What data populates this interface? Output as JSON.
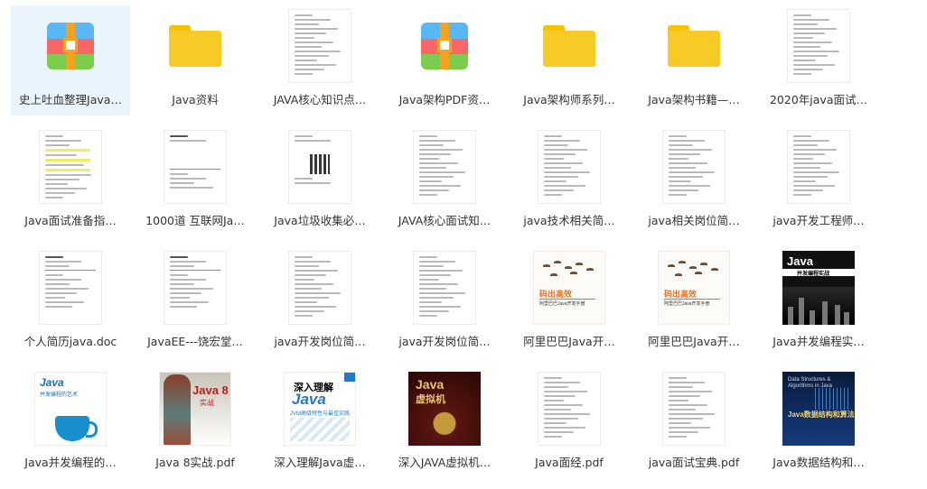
{
  "files": [
    {
      "label": "史上吐血整理Java…",
      "kind": "archive",
      "selected": true
    },
    {
      "label": "Java资料",
      "kind": "folder"
    },
    {
      "label": "JAVA核心知识点…",
      "kind": "doc"
    },
    {
      "label": "Java架构PDF资…",
      "kind": "archive"
    },
    {
      "label": "Java架构师系列…",
      "kind": "folder"
    },
    {
      "label": "Java架构书籍—…",
      "kind": "folder"
    },
    {
      "label": "2020年java面试…",
      "kind": "doc"
    },
    {
      "label": "Java面试准备指…",
      "kind": "doc-yellow"
    },
    {
      "label": "1000道 互联网Ja…",
      "kind": "doc-sparse"
    },
    {
      "label": "Java垃圾收集必…",
      "kind": "doc-qr"
    },
    {
      "label": "JAVA核心面试知…",
      "kind": "doc"
    },
    {
      "label": "java技术相关简…",
      "kind": "doc"
    },
    {
      "label": "java相关岗位简…",
      "kind": "doc"
    },
    {
      "label": "java开发工程师…",
      "kind": "doc"
    },
    {
      "label": "个人简历java.doc",
      "kind": "doc-table"
    },
    {
      "label": "JavaEE---饶宏堂…",
      "kind": "doc-table"
    },
    {
      "label": "java开发岗位简…",
      "kind": "doc"
    },
    {
      "label": "java开发岗位简…",
      "kind": "doc"
    },
    {
      "label": "阿里巴巴Java开…",
      "kind": "cover-ali"
    },
    {
      "label": "阿里巴巴Java开…",
      "kind": "cover-ali"
    },
    {
      "label": "Java并发编程实…",
      "kind": "cover-conc"
    },
    {
      "label": "Java并发编程的…",
      "kind": "cover-art"
    },
    {
      "label": "Java 8实战.pdf",
      "kind": "cover-j8"
    },
    {
      "label": "深入理解Java虚…",
      "kind": "cover-jvm1"
    },
    {
      "label": "深入JAVA虚拟机…",
      "kind": "cover-jvm2"
    },
    {
      "label": "Java面经.pdf",
      "kind": "doc"
    },
    {
      "label": "java面试宝典.pdf",
      "kind": "doc"
    },
    {
      "label": "Java数据结构和…",
      "kind": "cover-ds"
    }
  ],
  "covers": {
    "ali": {
      "title": "码出高效",
      "subtitle": "阿里巴巴Java开发手册"
    },
    "conc": {
      "title": "Java",
      "subtitle": "并发编程实战"
    },
    "art": {
      "title": "Java",
      "subtitle": "并发编程的艺术"
    },
    "j8": {
      "title": "Java 8",
      "subtitle": "实战"
    },
    "jvm1": {
      "title": "深入理解",
      "big": "Java",
      "subtitle": "JVM高级特性与最佳实践"
    },
    "jvm2": {
      "title": "Java",
      "subtitle": "虚拟机"
    },
    "ds": {
      "title": "Data Structures & Algorithms in Java",
      "subtitle": "Java数据结构和算法"
    }
  }
}
